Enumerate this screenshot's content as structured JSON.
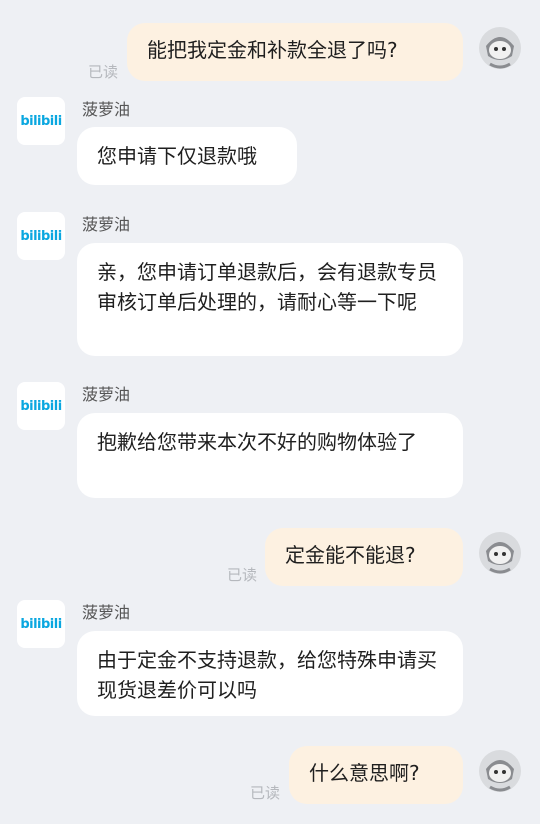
{
  "read_label": "已读",
  "shop": {
    "name": "菠萝油",
    "logo_text": "bilibili"
  },
  "messages": [
    {
      "from": "user",
      "text": "能把我定金和补款全退了吗?"
    },
    {
      "from": "shop",
      "text": "您申请下仅退款哦"
    },
    {
      "from": "shop",
      "text": "亲，您申请订单退款后，会有退款专员审核订单后处理的，请耐心等一下呢"
    },
    {
      "from": "shop",
      "text": "抱歉给您带来本次不好的购物体验了"
    },
    {
      "from": "user",
      "text": "定金能不能退?"
    },
    {
      "from": "shop",
      "text": "由于定金不支持退款，给您特殊申请买现货退差价可以吗"
    },
    {
      "from": "user",
      "text": "什么意思啊?"
    }
  ],
  "colors": {
    "background": "#eef0f4",
    "outgoing_bubble": "#fdf1e1",
    "incoming_bubble": "#ffffff",
    "logo": "#0aa7e0"
  }
}
